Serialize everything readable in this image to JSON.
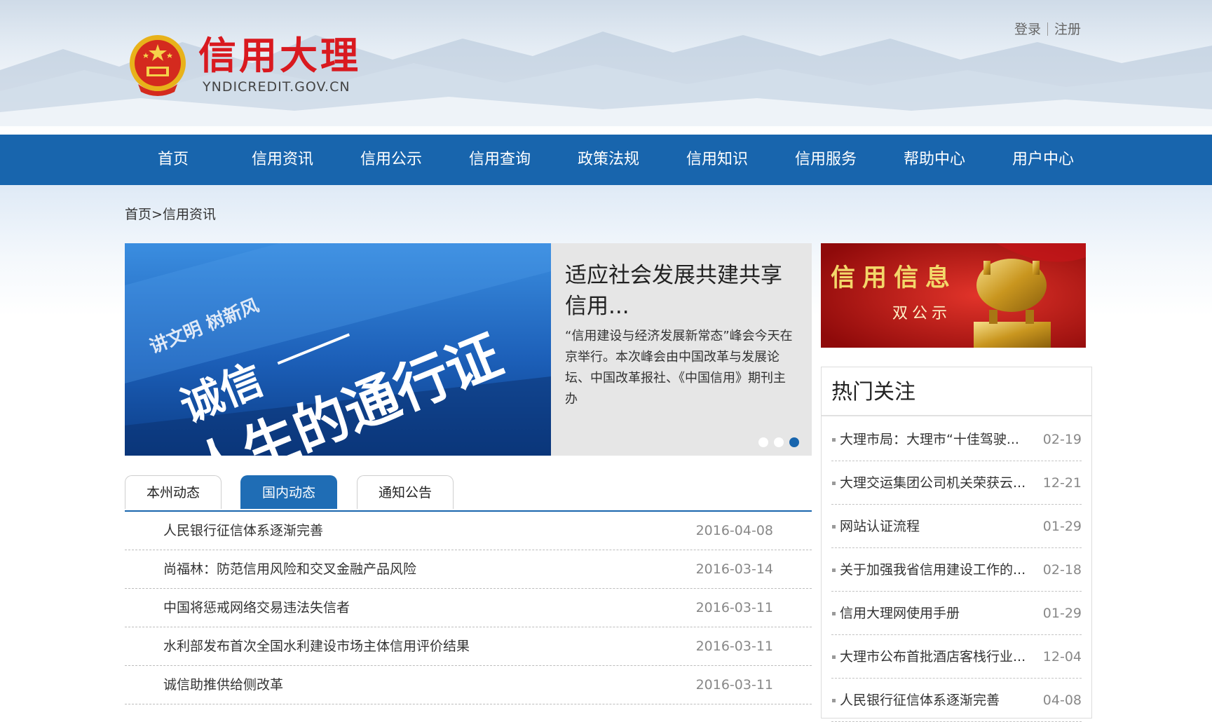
{
  "header": {
    "site_title": "信用大理",
    "site_domain": "YNDICREDIT.GOV.CN",
    "login": "登录",
    "register": "注册"
  },
  "nav": {
    "items": [
      "首页",
      "信用资讯",
      "信用公示",
      "信用查询",
      "政策法规",
      "信用知识",
      "信用服务",
      "帮助中心",
      "用户中心"
    ]
  },
  "breadcrumb": {
    "home": "首页",
    "separator": ">",
    "current": "信用资讯"
  },
  "banner": {
    "image_text_1": "诚信",
    "image_text_2": "人生的通行证",
    "image_text_3": "讲文明 树新风",
    "title": "适应社会发展共建共享信用...",
    "description": "“信用建设与经济发展新常态”峰会今天在京举行。本次峰会由中国改革与发展论坛、中国改革报社、《中国信用》期刊主办",
    "active_slide": 3,
    "slide_count": 3
  },
  "tabs": {
    "items": [
      "本州动态",
      "国内动态",
      "通知公告"
    ],
    "active_index": 1
  },
  "news": {
    "rows": [
      {
        "title": "人民银行征信体系逐渐完善",
        "date": "2016-04-08"
      },
      {
        "title": "尚福林：防范信用风险和交叉金融产品风险",
        "date": "2016-03-14"
      },
      {
        "title": "中国将惩戒网络交易违法失信者",
        "date": "2016-03-11"
      },
      {
        "title": "水利部发布首次全国水利建设市场主体信用评价结果",
        "date": "2016-03-11"
      },
      {
        "title": "诚信助推供给侧改革",
        "date": "2016-03-11"
      }
    ]
  },
  "side_banner": {
    "title": "信用信息",
    "subtitle": "双公示"
  },
  "hot": {
    "title": "热门关注",
    "rows": [
      {
        "title": "大理市局：大理市“十佳驾驶...",
        "date": "02-19"
      },
      {
        "title": "大理交运集团公司机关荣获云...",
        "date": "12-21"
      },
      {
        "title": "网站认证流程",
        "date": "01-29"
      },
      {
        "title": "关于加强我省信用建设工作的...",
        "date": "02-18"
      },
      {
        "title": "信用大理网使用手册",
        "date": "01-29"
      },
      {
        "title": "大理市公布首批酒店客栈行业...",
        "date": "12-04"
      },
      {
        "title": "人民银行征信体系逐渐完善",
        "date": "04-08"
      }
    ]
  },
  "colors": {
    "nav_blue": "#1865ad",
    "brand_red": "#d9191f",
    "tab_active": "#1f6db5"
  },
  "icons": {
    "emblem": "national-emblem-icon"
  }
}
